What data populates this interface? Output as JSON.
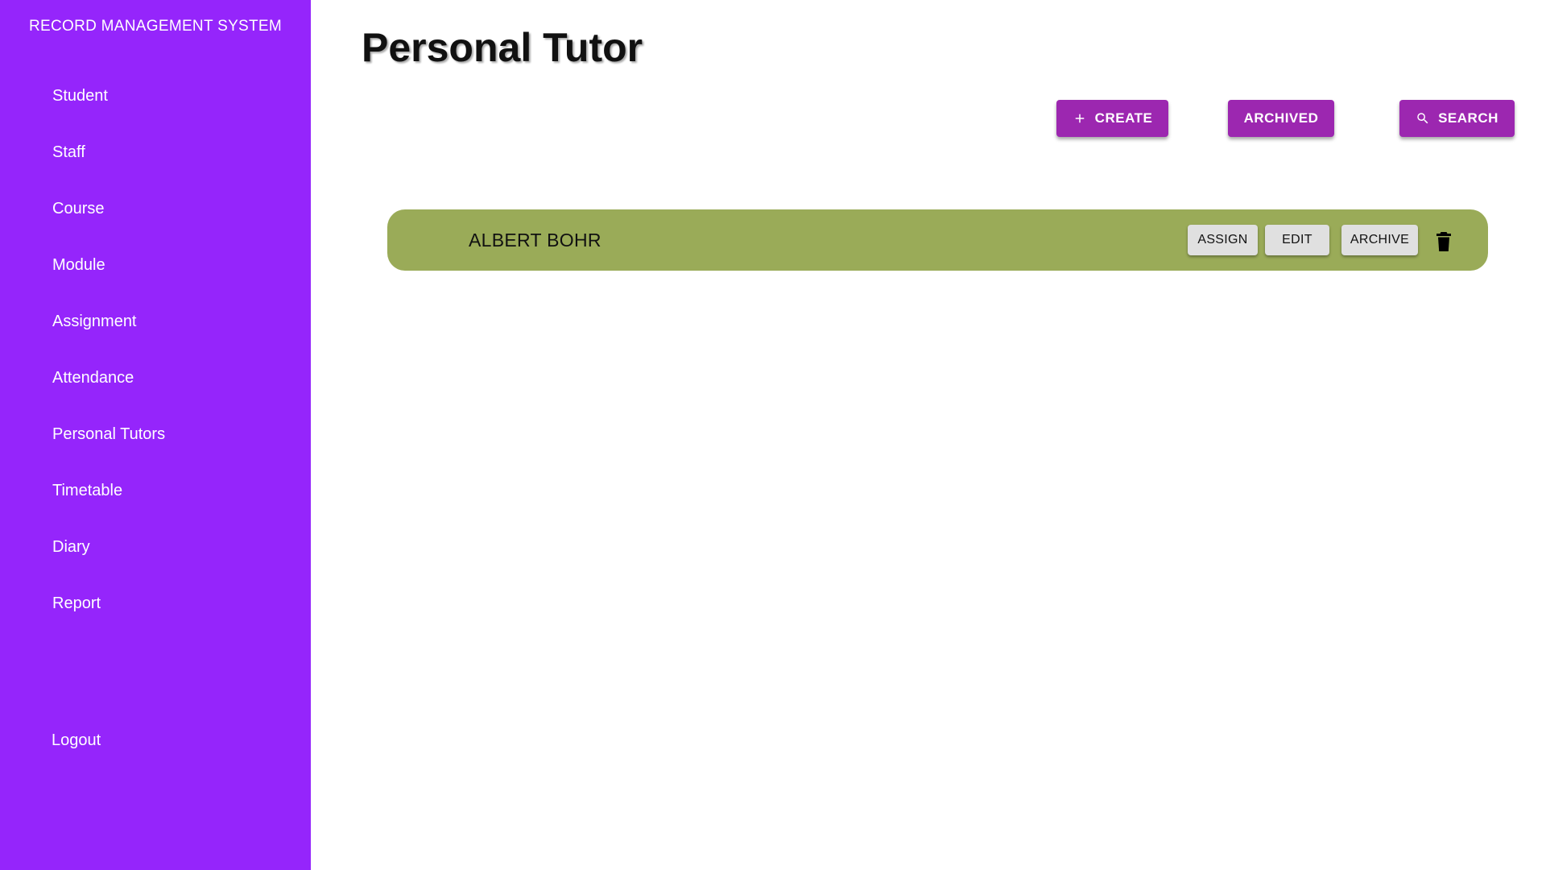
{
  "sidebar": {
    "brand": "RECORD MANAGEMENT SYSTEM",
    "items": [
      {
        "label": "Student"
      },
      {
        "label": "Staff"
      },
      {
        "label": "Course"
      },
      {
        "label": "Module"
      },
      {
        "label": "Assignment"
      },
      {
        "label": "Attendance"
      },
      {
        "label": "Personal Tutors"
      },
      {
        "label": "Timetable"
      },
      {
        "label": "Diary"
      },
      {
        "label": "Report"
      }
    ],
    "logout": "Logout"
  },
  "main": {
    "title": "Personal Tutor",
    "toolbar": {
      "create_label": "CREATE",
      "create_icon": "plus-icon",
      "archived_label": "ARCHIVED",
      "search_label": "SEARCH",
      "search_icon": "search-icon"
    },
    "records": [
      {
        "name": "ALBERT BOHR",
        "assign_label": "ASSIGN",
        "edit_label": "EDIT",
        "archive_label": "ARCHIVE",
        "delete_icon": "trash-icon"
      }
    ]
  },
  "colors": {
    "sidebar": "#9525fb",
    "primary_button": "#9c27b0",
    "record_row": "#9aab58",
    "row_button": "#e0e0e0"
  }
}
